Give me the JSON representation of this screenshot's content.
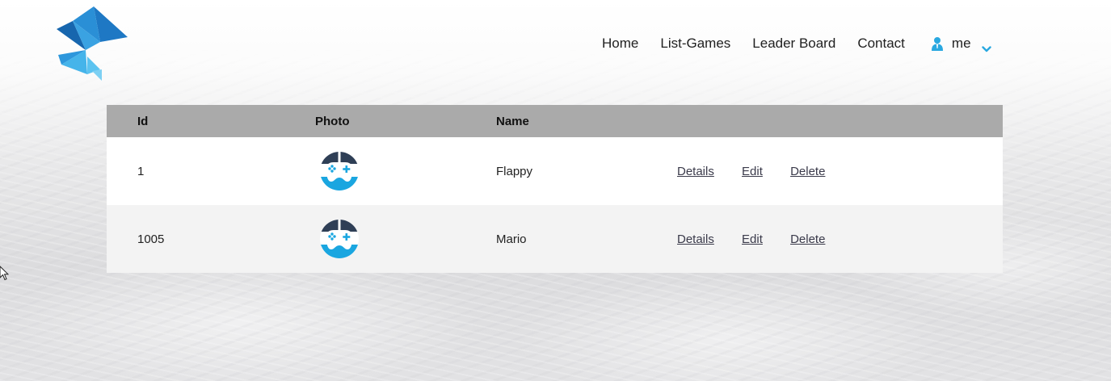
{
  "colors": {
    "accent": "#29a8e0",
    "header_row": "#aaaaaa",
    "row_alt": "#f3f3f3",
    "logo_dark": "#1b6fb8",
    "logo_light": "#3fb6ec"
  },
  "header": {
    "logo_icon": "geometric-triangles-logo",
    "nav": {
      "home": "Home",
      "list_games": "List-Games",
      "leader_board": "Leader Board",
      "contact": "Contact"
    },
    "user": {
      "icon": "user-icon",
      "name": "me",
      "dropdown_icon": "chevron-down-icon"
    }
  },
  "table": {
    "columns": {
      "id": "Id",
      "photo": "Photo",
      "name": "Name"
    },
    "rows": [
      {
        "id": "1",
        "photo_icon": "gamepad-icon",
        "name": "Flappy",
        "details": "Details",
        "edit": "Edit",
        "delete": "Delete"
      },
      {
        "id": "1005",
        "photo_icon": "gamepad-icon",
        "name": "Mario",
        "details": "Details",
        "edit": "Edit",
        "delete": "Delete"
      }
    ]
  }
}
